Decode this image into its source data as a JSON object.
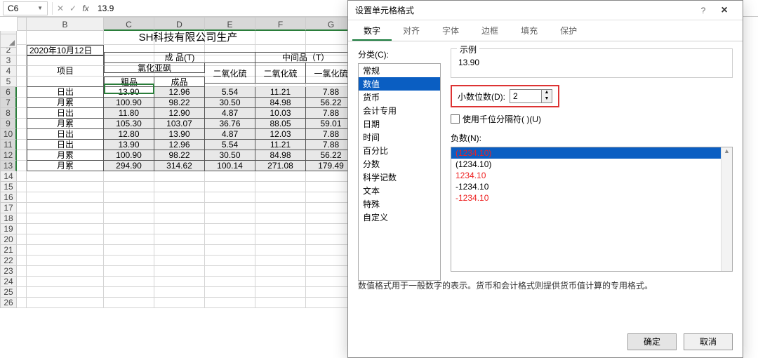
{
  "formula_bar": {
    "name_box": "C6",
    "fx_label": "fx",
    "formula": "13.9"
  },
  "col_headers": [
    "B",
    "C",
    "D",
    "E",
    "F",
    "G"
  ],
  "row_numbers": [
    1,
    2,
    3,
    4,
    5,
    6,
    7,
    8,
    9,
    10,
    11,
    12,
    13,
    14,
    15,
    16,
    17,
    18,
    19,
    20,
    21,
    22,
    23,
    24,
    25,
    26
  ],
  "sheet": {
    "title": "SH科技有限公司生产",
    "date": "2020年10月12日",
    "h_item": "项目",
    "h_chengpin": "成 品(T)",
    "h_zhongjian": "中间品（T）",
    "h_lhyf": "氯化亚砜",
    "h_cupin": "粗品",
    "h_chengpin2": "成品",
    "h_eyh1": "二氧化硫",
    "h_eyh2": "二氧化硫",
    "h_ylh": "一氯化硫",
    "rows": [
      {
        "label": "日出",
        "c": "13.90",
        "d": "12.96",
        "e": "5.54",
        "f": "11.21",
        "g": "7.88"
      },
      {
        "label": "月累",
        "c": "100.90",
        "d": "98.22",
        "e": "30.50",
        "f": "84.98",
        "g": "56.22"
      },
      {
        "label": "日出",
        "c": "11.80",
        "d": "12.90",
        "e": "4.87",
        "f": "10.03",
        "g": "7.88"
      },
      {
        "label": "月累",
        "c": "105.30",
        "d": "103.07",
        "e": "36.76",
        "f": "88.05",
        "g": "59.01"
      },
      {
        "label": "日出",
        "c": "12.80",
        "d": "13.90",
        "e": "4.87",
        "f": "12.03",
        "g": "7.88"
      },
      {
        "label": "日出",
        "c": "13.90",
        "d": "12.96",
        "e": "5.54",
        "f": "11.21",
        "g": "7.88"
      },
      {
        "label": "月累",
        "c": "100.90",
        "d": "98.22",
        "e": "30.50",
        "f": "84.98",
        "g": "56.22"
      },
      {
        "label": "月累",
        "c": "294.90",
        "d": "314.62",
        "e": "100.14",
        "f": "271.08",
        "g": "179.49"
      }
    ]
  },
  "dialog": {
    "title": "设置单元格格式",
    "help": "?",
    "close": "×",
    "tabs": [
      "数字",
      "对齐",
      "字体",
      "边框",
      "填充",
      "保护"
    ],
    "active_tab": 0,
    "category_label": "分类(C):",
    "categories": [
      "常规",
      "数值",
      "货币",
      "会计专用",
      "日期",
      "时间",
      "百分比",
      "分数",
      "科学记数",
      "文本",
      "特殊",
      "自定义"
    ],
    "selected_category": 1,
    "example_label": "示例",
    "example_value": "13.90",
    "decimal_label": "小数位数(D):",
    "decimal_value": "2",
    "thousand_label": "使用千位分隔符( )(U)",
    "neg_label": "负数(N):",
    "neg_items": [
      {
        "text": "(1234.10)",
        "red": true,
        "sel": true
      },
      {
        "text": "(1234.10)",
        "red": false
      },
      {
        "text": "1234.10",
        "red": true
      },
      {
        "text": "-1234.10",
        "red": false
      },
      {
        "text": "-1234.10",
        "red": true
      }
    ],
    "hint": "数值格式用于一般数字的表示。货币和会计格式则提供货币值计算的专用格式。",
    "ok": "确定",
    "cancel": "取消"
  }
}
